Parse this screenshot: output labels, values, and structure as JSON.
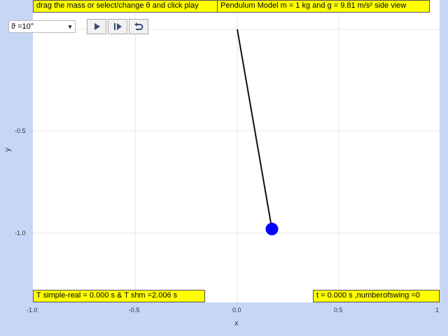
{
  "header": {
    "instruction": "drag the mass or select/change θ and click play",
    "title": "Pendulum Model m = 1 kg and g = 9.81 m/s² side view"
  },
  "controls": {
    "angle_select": "ϑ =10°",
    "play_icon": "play-icon",
    "step_icon": "step-forward-icon",
    "reset_icon": "reset-icon"
  },
  "readouts": {
    "period": "T simple-real = 0.000 s & T shm =2.006 s",
    "time": "t = 0.000 s ,numberofswing =0"
  },
  "axes": {
    "xlabel": "x",
    "ylabel": "y",
    "xticks": [
      "-1.0",
      "-0.5",
      "0.0",
      "0.5",
      "1"
    ],
    "yticks": [
      "-0.5",
      "-1.0"
    ]
  },
  "pendulum": {
    "pivot_x": 0.0,
    "pivot_y": 0.0,
    "bob_x": 0.17,
    "bob_y": -0.98,
    "bob_color": "#0000ff"
  }
}
